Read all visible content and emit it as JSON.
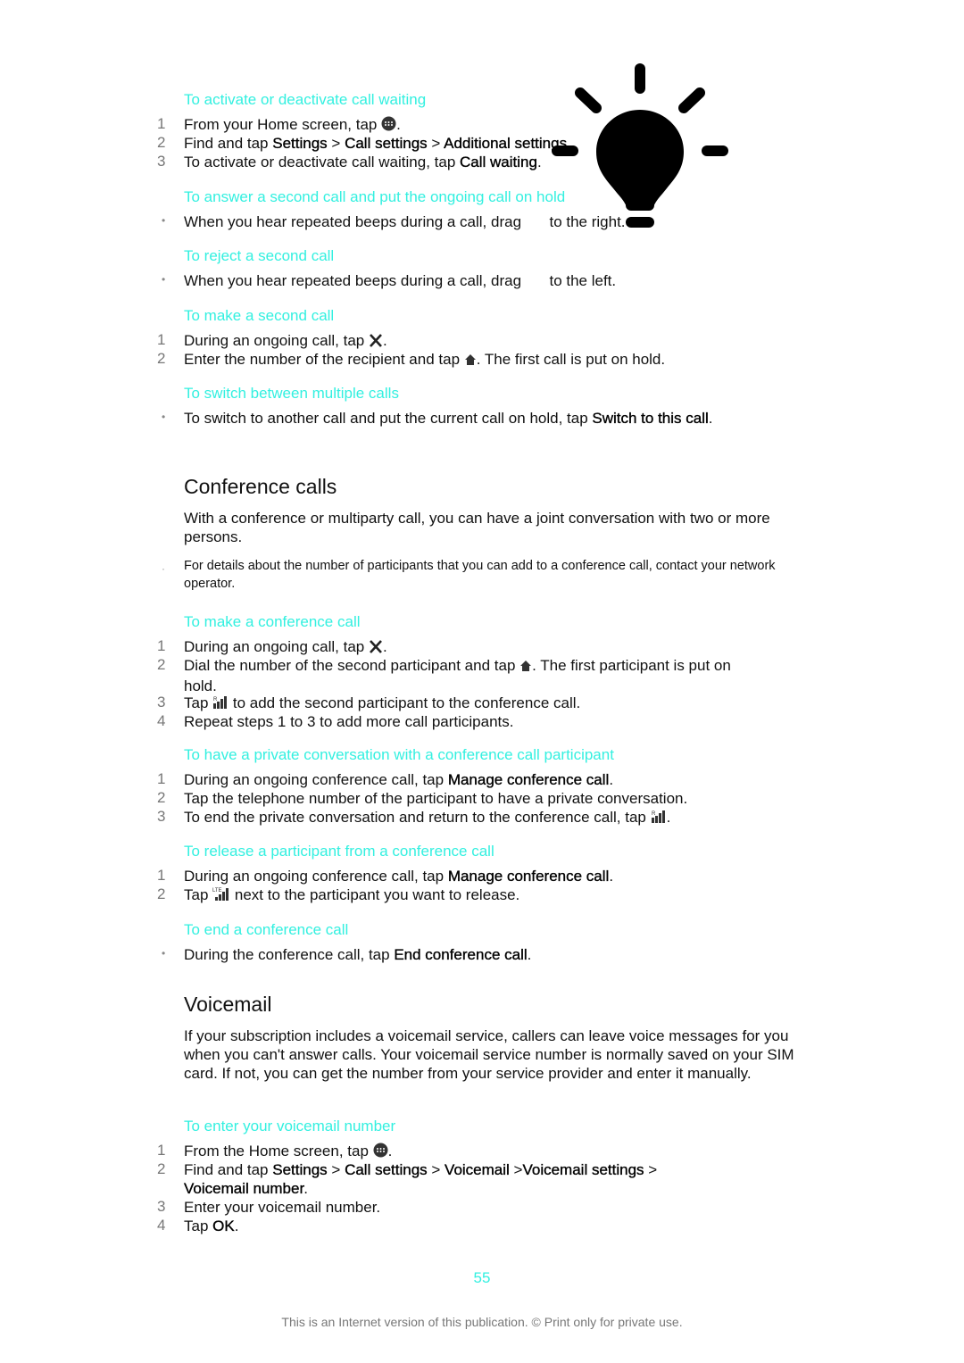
{
  "sections": {
    "call_waiting": {
      "heading": "To activate or deactivate call waiting",
      "steps": [
        {
          "n": "1",
          "a": "From your Home screen, tap ",
          "b": "."
        },
        {
          "n": "2",
          "a": "Find and tap ",
          "s1": "Settings",
          "sep1": " > ",
          "s2": "Call settings",
          "sep2": " > ",
          "s3": "Additional settings",
          "end": "."
        },
        {
          "n": "3",
          "a": "To activate or deactivate call waiting, tap ",
          "s1": "Call waiting",
          "end": "."
        }
      ]
    },
    "answer_second": {
      "heading": "To answer a second call and put the ongoing call on hold",
      "bullet": "•",
      "a": "When you hear repeated beeps during a call, drag ",
      "b": " to the right."
    },
    "reject_second": {
      "heading": "To reject a second call",
      "bullet": "•",
      "a": "When you hear repeated beeps during a call, drag ",
      "b": " to the left."
    },
    "make_second": {
      "heading": "To make a second call",
      "steps": [
        {
          "n": "1",
          "a": "During an ongoing call, tap ",
          "b": "."
        },
        {
          "n": "2",
          "a": "Enter the number of the recipient and tap ",
          "b": ". The first call is put on hold."
        }
      ]
    },
    "switch_calls": {
      "heading": "To switch between multiple calls",
      "bullet": "•",
      "a": "To switch to another call and put the current call on hold, tap ",
      "s1": "Switch to this call",
      "end": "."
    },
    "conference": {
      "title": "Conference calls",
      "intro": "With a conference or multiparty call, you can have a joint conversation with two or more persons.",
      "note_marker": "·",
      "note": "For details about the number of participants that you can add to a conference call, contact your network operator."
    },
    "make_conference": {
      "heading": "To make a conference call",
      "steps": [
        {
          "n": "1",
          "a": "During an ongoing call, tap ",
          "b": "."
        },
        {
          "n": "2",
          "a": "Dial the number of the second participant and tap ",
          "b": ". The first participant is put on hold."
        },
        {
          "n": "3",
          "a": "Tap ",
          "b": " to add the second participant to the conference call."
        },
        {
          "n": "4",
          "a": "Repeat steps 1 to 3 to add more call participants."
        }
      ]
    },
    "private_conversation": {
      "heading": "To have a private conversation with a conference call participant",
      "steps": [
        {
          "n": "1",
          "a": "During an ongoing conference call, tap ",
          "s1": "Manage conference call",
          "end": "."
        },
        {
          "n": "2",
          "a": "Tap the telephone number of the participant to have a private conversation."
        },
        {
          "n": "3",
          "a": "To end the private conversation and return to the conference call, tap ",
          "b": "."
        }
      ]
    },
    "release_participant": {
      "heading": "To release a participant from a conference call",
      "steps": [
        {
          "n": "1",
          "a": "During an ongoing conference call, tap ",
          "s1": "Manage conference call",
          "end": "."
        },
        {
          "n": "2",
          "a": "Tap ",
          "b": " next to the participant you want to release."
        }
      ]
    },
    "end_conference": {
      "heading": "To end a conference call",
      "bullet": "•",
      "a": "During the conference call, tap ",
      "s1": "End conference call",
      "end": "."
    },
    "voicemail": {
      "title": "Voicemail",
      "intro": "If your subscription includes a voicemail service, callers can leave voice messages for you when you can't answer calls. Your voicemail service number is normally saved on your SIM card. If not, you can get the number from your service provider and enter it manually."
    },
    "enter_voicemail": {
      "heading": "To enter your voicemail number",
      "steps": [
        {
          "n": "1",
          "a": "From the Home screen, tap ",
          "b": "."
        },
        {
          "n": "2",
          "a": "Find and tap ",
          "s1": "Settings",
          "sep1": " > ",
          "s2": "Call settings",
          "sep2": " > ",
          "s3": "Voicemail",
          "sep3": " >",
          "s4": "Voicemail settings",
          "sep4": " > ",
          "s5": "Voicemail number",
          "end": "."
        },
        {
          "n": "3",
          "a": "Enter your voicemail number."
        },
        {
          "n": "4",
          "a": "Tap ",
          "s1": "OK",
          "end": "."
        }
      ]
    }
  },
  "icons": {
    "apps": "apps-grid-icon",
    "add_call": "add-call-x-icon",
    "hold": "hold-home-icon",
    "merge": "merge-calls-signal-icon",
    "release": "release-lte-signal-icon",
    "overlay": "lightbulb-icon"
  },
  "footer": {
    "page_number": "55",
    "notice": "This is an Internet version of this publication. © Print only for private use."
  },
  "colors": {
    "heading_accent": "#33f0e0",
    "body_text": "#111111",
    "step_number": "#777777"
  }
}
